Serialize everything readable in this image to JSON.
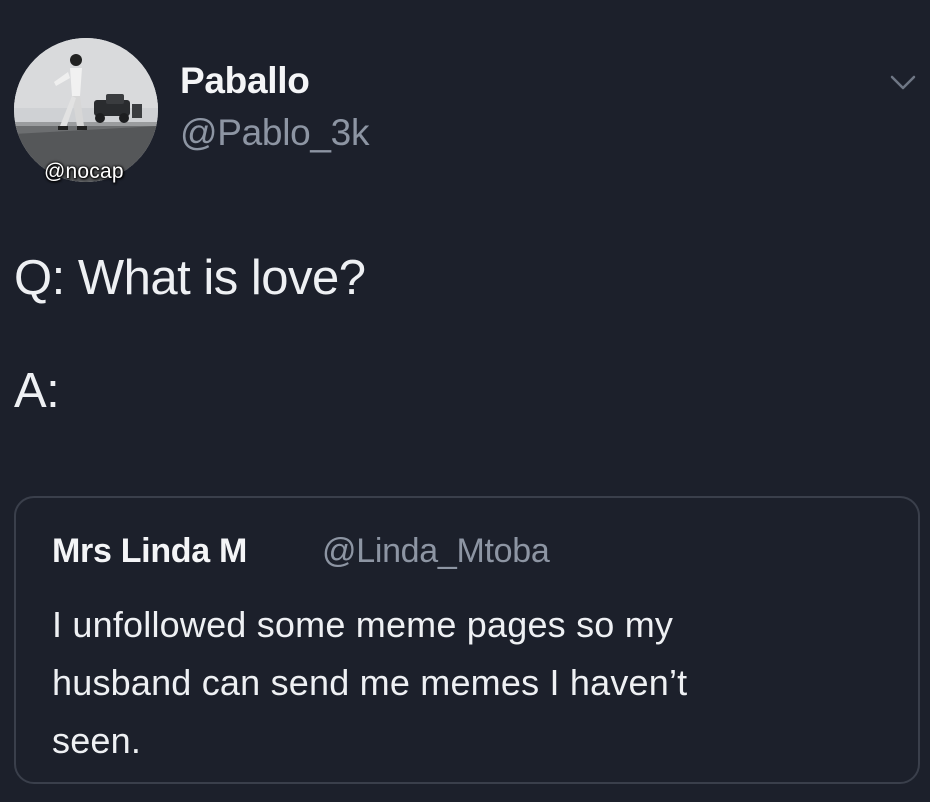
{
  "tweet": {
    "author": {
      "display_name": "Paballo",
      "handle": "@Pablo_3k",
      "avatar_icon": "profile-photo"
    },
    "watermark": "@nocap",
    "menu_icon": "chevron-down-icon",
    "body": {
      "line_q": "Q: What is love?",
      "line_a": "A:"
    },
    "quoted_tweet": {
      "display_name": "Mrs Linda  M",
      "handle": "@Linda_Mtoba",
      "text_lines": [
        "I unfollowed some meme pages so my",
        "husband can send me memes I haven’t",
        "seen."
      ]
    }
  },
  "colors": {
    "background": "#1c202b",
    "primary_text": "#f4f5f7",
    "secondary_text": "#8d95a3",
    "border": "#3a3f4b"
  }
}
